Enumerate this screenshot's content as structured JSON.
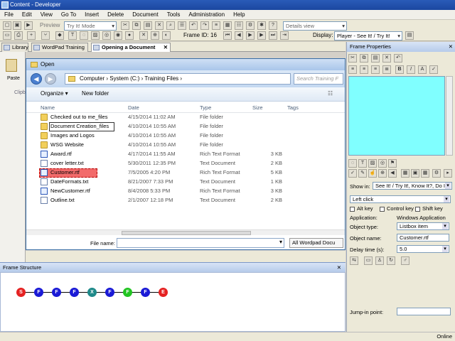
{
  "app": {
    "title": "Content - Developer"
  },
  "menu": [
    "File",
    "Edit",
    "View",
    "Go To",
    "Insert",
    "Delete",
    "Document",
    "Tools",
    "Administration",
    "Help"
  ],
  "toolbar": {
    "preview_label": "Preview",
    "mode_value": "Try It! Mode",
    "view_value": "Details view",
    "frame_id_label": "Frame ID:",
    "frame_id_value": "16",
    "display_label": "Display:",
    "display_value": "Player - See It! / Try It!"
  },
  "tabs": [
    {
      "label": "Library"
    },
    {
      "label": "WordPad Training"
    },
    {
      "label": "Opening a Document"
    }
  ],
  "left_pane": {
    "paste_label": "Paste",
    "clipboard_label": "Clipbo"
  },
  "dialog": {
    "title": "Open",
    "breadcrumb": "Computer  ›  System (C:)  ›  Training Files  ›",
    "search_placeholder": "Search Training F",
    "organize_label": "Organize ▾",
    "new_folder_label": "New folder",
    "columns": {
      "name": "Name",
      "date": "Date",
      "type": "Type",
      "size": "Size",
      "tags": "Tags"
    },
    "files": [
      {
        "name": "Checked out to me_files",
        "date": "4/15/2014 11:02 AM",
        "type": "File folder",
        "size": "",
        "kind": "folder"
      },
      {
        "name": "Document Creation_files",
        "date": "4/10/2014 10:55 AM",
        "type": "File folder",
        "size": "",
        "kind": "folder"
      },
      {
        "name": "Images and Logos",
        "date": "4/10/2014 10:55 AM",
        "type": "File folder",
        "size": "",
        "kind": "folder"
      },
      {
        "name": "WSG Website",
        "date": "4/10/2014 10:55 AM",
        "type": "File folder",
        "size": "",
        "kind": "folder"
      },
      {
        "name": "Award.rtf",
        "date": "4/17/2014 11:55 AM",
        "type": "Rich Text Format",
        "size": "3 KB",
        "kind": "rtf"
      },
      {
        "name": "cover letter.txt",
        "date": "5/30/2011 12:35 PM",
        "type": "Text Document",
        "size": "2 KB",
        "kind": "doc"
      },
      {
        "name": "Customer.rtf",
        "date": "7/5/2005 4:20 PM",
        "type": "Rich Text Format",
        "size": "5 KB",
        "kind": "rtf"
      },
      {
        "name": "DateFormats.txt",
        "date": "8/21/2007 7:33 PM",
        "type": "Text Document",
        "size": "1 KB",
        "kind": "doc"
      },
      {
        "name": "NewCustomer.rtf",
        "date": "8/4/2008 5:33 PM",
        "type": "Rich Text Format",
        "size": "3 KB",
        "kind": "rtf"
      },
      {
        "name": "Outline.txt",
        "date": "2/1/2007 12:18 PM",
        "type": "Text Document",
        "size": "2 KB",
        "kind": "doc"
      }
    ],
    "file_name_label": "File name:",
    "file_name_value": "",
    "filter_value": "All Wordpad Docu"
  },
  "frame_structure": {
    "title": "Frame Structure",
    "nodes": [
      {
        "label": "S",
        "color": "#e52222"
      },
      {
        "label": "F",
        "color": "#1a1ad6"
      },
      {
        "label": "F",
        "color": "#1a1ad6"
      },
      {
        "label": "F",
        "color": "#1a1ad6"
      },
      {
        "label": "X",
        "color": "#1f8a8a"
      },
      {
        "label": "F",
        "color": "#1a1ad6"
      },
      {
        "label": "F",
        "color": "#22c422"
      },
      {
        "label": "F",
        "color": "#1a1ad6"
      },
      {
        "label": "E",
        "color": "#e52222"
      }
    ]
  },
  "frame_properties": {
    "title": "Frame Properties",
    "show_in_label": "Show in:",
    "show_in_value": "See It! / Try It!, Know It?, Do It!",
    "action_value": "Left click",
    "alt_key_label": "Alt key",
    "control_key_label": "Control key",
    "shift_key_label": "Shift key",
    "application_label": "Application:",
    "application_value": "Windows Application",
    "object_type_label": "Object type:",
    "object_type_value": "Listbox item",
    "object_name_label": "Object name:",
    "object_name_value": "Customer.rtf",
    "delay_label": "Delay time (s):",
    "delay_value": "5.0",
    "jump_in_label": "Jump-in point:",
    "jump_in_value": ""
  },
  "status": {
    "online": "Online"
  },
  "colors": {
    "selection": "#f26b6b",
    "cyan_area": "#80ffff",
    "title_blue": "#1b47a0"
  }
}
